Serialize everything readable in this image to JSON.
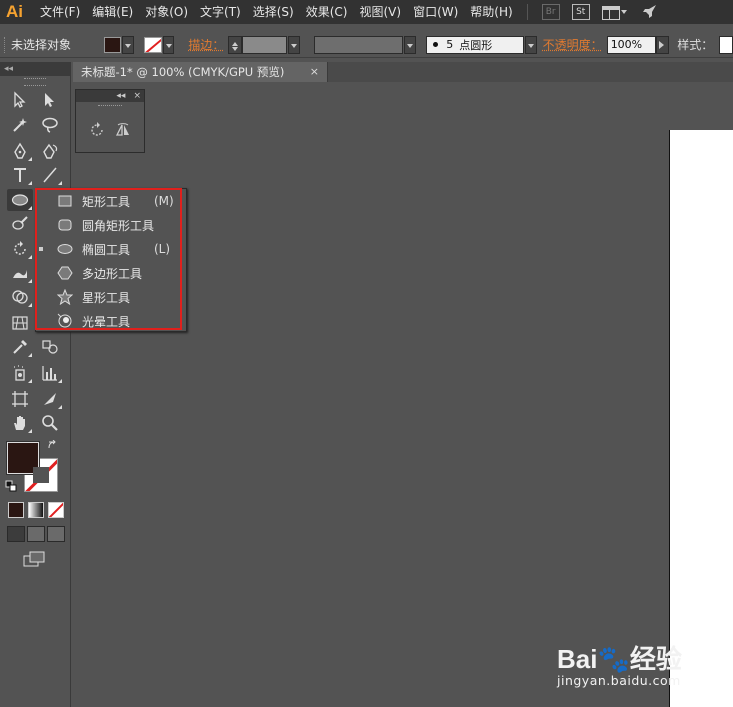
{
  "app": {
    "logo": "Ai"
  },
  "menubar": {
    "items": [
      "文件(F)",
      "编辑(E)",
      "对象(O)",
      "文字(T)",
      "选择(S)",
      "效果(C)",
      "视图(V)",
      "窗口(W)",
      "帮助(H)"
    ],
    "br_label": "Br",
    "st_label": "St"
  },
  "control_bar": {
    "selection_status": "未选择对象",
    "stroke_label": "描边：",
    "brush_size": "5",
    "brush_name": "点圆形",
    "opacity_label": "不透明度：",
    "opacity_value": "100%",
    "style_label": "样式："
  },
  "document_tab": {
    "title": "未标题-1* @ 100% (CMYK/GPU 预览)",
    "close": "×"
  },
  "toolbox": {
    "header_collapse": "◂◂"
  },
  "float_panel": {
    "collapse": "◂◂",
    "close": "×"
  },
  "flyout": {
    "items": [
      {
        "label": "矩形工具",
        "shortcut": "(M)",
        "icon": "rectangle-icon",
        "active": false
      },
      {
        "label": "圆角矩形工具",
        "shortcut": "",
        "icon": "rounded-rectangle-icon",
        "active": false
      },
      {
        "label": "椭圆工具",
        "shortcut": "(L)",
        "icon": "ellipse-icon",
        "active": true
      },
      {
        "label": "多边形工具",
        "shortcut": "",
        "icon": "polygon-icon",
        "active": false
      },
      {
        "label": "星形工具",
        "shortcut": "",
        "icon": "star-icon",
        "active": false
      },
      {
        "label": "光晕工具",
        "shortcut": "",
        "icon": "flare-icon",
        "active": false
      }
    ],
    "highlight_color": "#e0201c"
  },
  "colors": {
    "fill": "#2a1612",
    "stroke_none": "#e02020",
    "accent": "#f7a330"
  },
  "watermark": {
    "brand": "Bai🐾经验",
    "url": "jingyan.baidu.com"
  }
}
